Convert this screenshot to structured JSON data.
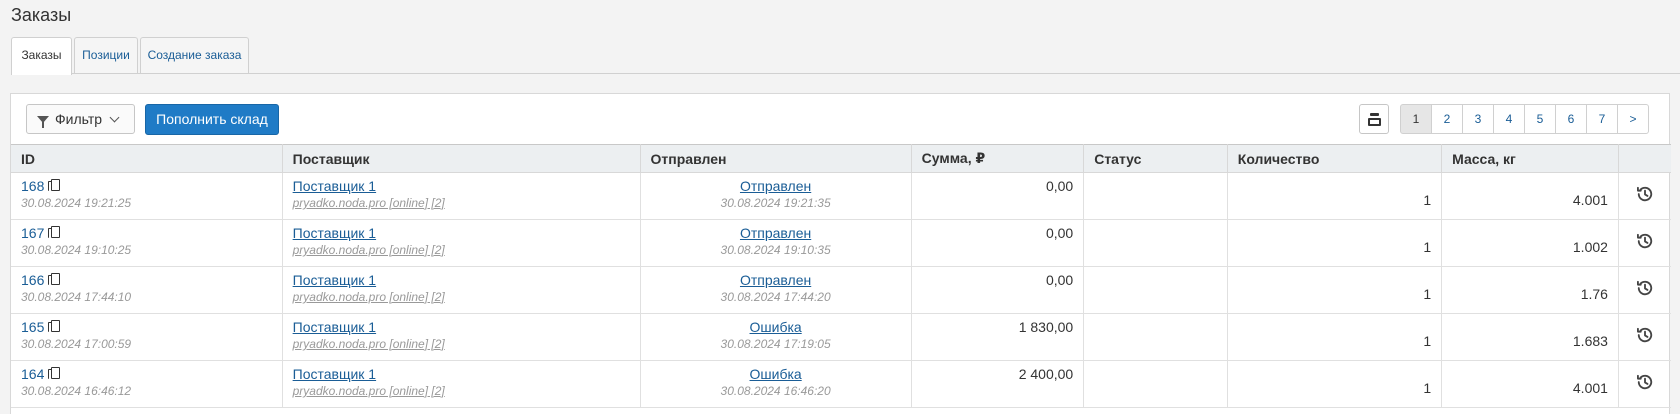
{
  "page": {
    "title": "Заказы"
  },
  "tabs": [
    {
      "label": "Заказы",
      "active": true
    },
    {
      "label": "Позиции",
      "active": false
    },
    {
      "label": "Создание заказа",
      "active": false
    }
  ],
  "toolbar": {
    "filter_label": "Фильтр",
    "restock_label": "Пополнить склад",
    "scale_icon": "weight-icon"
  },
  "pagination": {
    "pages": [
      "1",
      "2",
      "3",
      "4",
      "5",
      "6",
      "7",
      ">"
    ],
    "current": "1"
  },
  "table": {
    "headers": [
      "ID",
      "Поставщик",
      "Отправлен",
      "Сумма, ₽",
      "Статус",
      "Количество",
      "Масса, кг",
      ""
    ],
    "rows": [
      {
        "id": "168",
        "created": "30.08.2024 19:21:25",
        "supplier": "Поставщик 1",
        "supplier_sub": "pryadko.noda.pro [online] [2]",
        "sent": "Отправлен",
        "sent_time": "30.08.2024 19:21:35",
        "sum": "0,00",
        "status": "",
        "qty": "1",
        "mass": "4.001"
      },
      {
        "id": "167",
        "created": "30.08.2024 19:10:25",
        "supplier": "Поставщик 1",
        "supplier_sub": "pryadko.noda.pro [online] [2]",
        "sent": "Отправлен",
        "sent_time": "30.08.2024 19:10:35",
        "sum": "0,00",
        "status": "",
        "qty": "1",
        "mass": "1.002"
      },
      {
        "id": "166",
        "created": "30.08.2024 17:44:10",
        "supplier": "Поставщик 1",
        "supplier_sub": "pryadko.noda.pro [online] [2]",
        "sent": "Отправлен",
        "sent_time": "30.08.2024 17:44:20",
        "sum": "0,00",
        "status": "",
        "qty": "1",
        "mass": "1.76"
      },
      {
        "id": "165",
        "created": "30.08.2024 17:00:59",
        "supplier": "Поставщик 1",
        "supplier_sub": "pryadko.noda.pro [online] [2]",
        "sent": "Ошибка",
        "sent_time": "30.08.2024 17:19:05",
        "sum": "1 830,00",
        "status": "",
        "qty": "1",
        "mass": "1.683"
      },
      {
        "id": "164",
        "created": "30.08.2024 16:46:12",
        "supplier": "Поставщик 1",
        "supplier_sub": "pryadko.noda.pro [online] [2]",
        "sent": "Ошибка",
        "sent_time": "30.08.2024 16:46:20",
        "sum": "2 400,00",
        "status": "",
        "qty": "1",
        "mass": "4.001"
      }
    ]
  },
  "icons": {
    "copy": "copy-icon",
    "history": "history-icon",
    "filter": "filter-icon"
  },
  "colors": {
    "primary": "#1f7bc6",
    "link": "#1a5d96"
  }
}
